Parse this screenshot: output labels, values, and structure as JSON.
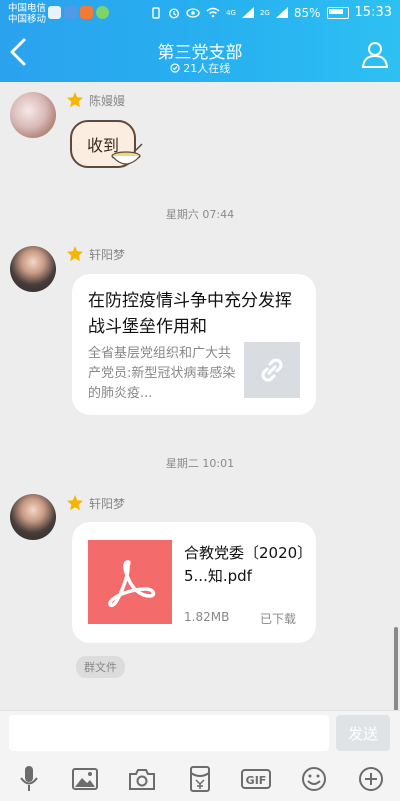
{
  "status_bar": {
    "carrier1": "中国电信",
    "carrier2": "中国移动",
    "network1": "4G",
    "network2": "2G",
    "battery": "85%",
    "time": "15:33"
  },
  "header": {
    "title": "第三党支部",
    "online": "21人在线"
  },
  "messages": [
    {
      "sender": "陈嫚嫚",
      "sticker_text": "收到"
    },
    {
      "timestamp": "星期六 07:44"
    },
    {
      "sender": "轩阳梦",
      "link_title": "在防控疫情斗争中充分发挥战斗堡垒作用和",
      "link_desc": "全省基层党组织和广大共产党员:新型冠状病毒感染的肺炎疫..."
    },
    {
      "timestamp": "星期二 10:01"
    },
    {
      "sender": "轩阳梦",
      "file_name": "合教党委〔2020〕5...知.pdf",
      "file_size": "1.82MB",
      "file_status": "已下载",
      "file_tag": "群文件"
    }
  ],
  "input": {
    "placeholder": "",
    "send_label": "发送"
  },
  "colors": {
    "header_gradient_start": "#2aa2ee",
    "header_gradient_end": "#2ec0f3",
    "pdf_icon_bg": "#f36b6b",
    "send_btn_disabled": "#dfe3e6"
  },
  "toolbar_icons": [
    "microphone-icon",
    "image-icon",
    "camera-icon",
    "red-packet-icon",
    "gif-icon",
    "emoji-icon",
    "plus-icon"
  ]
}
